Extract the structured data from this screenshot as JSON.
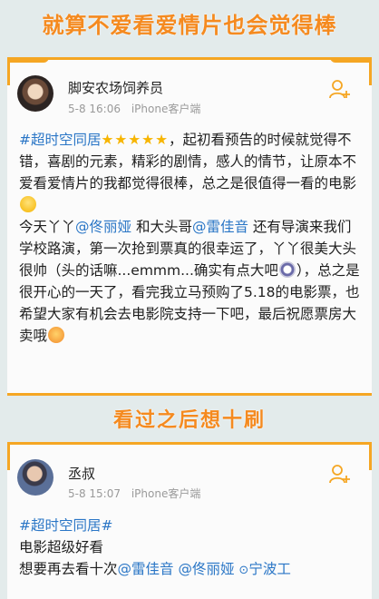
{
  "heading_top": "就算不爱看爱情片也会觉得棒",
  "heading_mid": "看过之后想十刷",
  "accent": "#f5a623",
  "link_color": "#2a76c6",
  "posts": [
    {
      "user": "脚安农场饲养员",
      "time": "5-8 16:06",
      "client": "iPhone客户端",
      "follow_icon": "add-follow-icon",
      "hashtag": "#超时空同居",
      "stars": "★★★★★",
      "s1": "，起初看预告的时候就觉得不错，喜剧的元素，精彩的剧情，感人的情节，让原本不爱看爱情片的我都觉得很棒，总之是很值得一看的电影",
      "s2": "今天丫丫",
      "mention1": "@佟丽娅",
      "s3": " 和大头哥",
      "mention2": "@雷佳音",
      "s4": " 还有导演来我们学校路演，第一次抢到票真的很幸运了，丫丫很美大头很帅（头的话嘛...emmm...确实有点大吧",
      "s5": "），总之是很开心的一天了，看完我立马预购了5.18的电影票，也希望大家有机会去电影院支持一下吧，最后祝愿票房大卖哦"
    },
    {
      "user": "丞叔",
      "time": "5-8 15:07",
      "client": "iPhone客户端",
      "follow_icon": "add-follow-icon",
      "hashtag": "#超时空同居#",
      "line2": "电影超级好看",
      "line3_a": "想要再去看十次",
      "mention1": "@雷佳音",
      "mention2": "@佟丽娅",
      "location": "宁波工"
    }
  ]
}
